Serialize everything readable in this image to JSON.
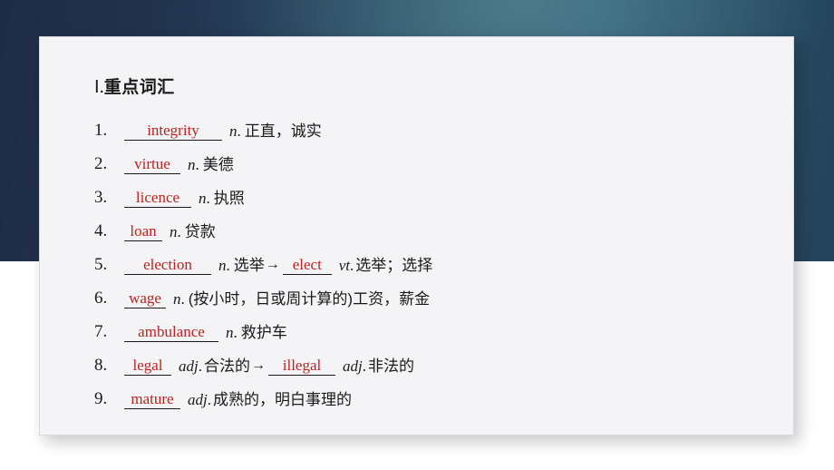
{
  "slide": {
    "section_title_numeral": "Ⅰ",
    "section_title_dot": ".",
    "section_title_text": "重点词汇"
  },
  "vocab": {
    "items": [
      {
        "num": "1.",
        "answer": "integrity",
        "pos": "n",
        "pos_dot": ".",
        "meaning": "正直，诚实",
        "arrow": "",
        "answer2": "",
        "pos2": "",
        "pos2_dot": "",
        "meaning2": ""
      },
      {
        "num": "2.",
        "answer": "virtue",
        "pos": "n",
        "pos_dot": ".",
        "meaning": "美德",
        "arrow": "",
        "answer2": "",
        "pos2": "",
        "pos2_dot": "",
        "meaning2": ""
      },
      {
        "num": "3.",
        "answer": "licence",
        "pos": "n",
        "pos_dot": ".",
        "meaning": "执照",
        "arrow": "",
        "answer2": "",
        "pos2": "",
        "pos2_dot": "",
        "meaning2": ""
      },
      {
        "num": "4.",
        "answer": "loan",
        "pos": "n",
        "pos_dot": ".",
        "meaning": "贷款",
        "arrow": "",
        "answer2": "",
        "pos2": "",
        "pos2_dot": "",
        "meaning2": ""
      },
      {
        "num": "5.",
        "answer": "election",
        "pos": "n",
        "pos_dot": ".",
        "meaning": "选举",
        "arrow": "→",
        "answer2": "elect",
        "pos2": "vt",
        "pos2_dot": ".",
        "meaning2": "选举；选择"
      },
      {
        "num": "6.",
        "answer": "wage",
        "pos": "n",
        "pos_dot": ".",
        "meaning": "(按小时，日或周计算的)工资，薪金",
        "arrow": "",
        "answer2": "",
        "pos2": "",
        "pos2_dot": "",
        "meaning2": ""
      },
      {
        "num": "7.",
        "answer": "ambulance",
        "pos": "n",
        "pos_dot": ".",
        "meaning": "救护车",
        "arrow": "",
        "answer2": "",
        "pos2": "",
        "pos2_dot": "",
        "meaning2": ""
      },
      {
        "num": "8.",
        "answer": "legal",
        "pos": "adj",
        "pos_dot": ".",
        "meaning": "合法的",
        "arrow": "→",
        "answer2": "illegal",
        "pos2": "adj",
        "pos2_dot": ".",
        "meaning2": "非法的"
      },
      {
        "num": "9.",
        "answer": "mature",
        "pos": "adj",
        "pos_dot": ".",
        "meaning": "成熟的，明白事理的",
        "arrow": "",
        "answer2": "",
        "pos2": "",
        "pos2_dot": "",
        "meaning2": ""
      }
    ]
  },
  "colors": {
    "answer_red": "#c0221f",
    "card_bg": "#f4f3f6",
    "text": "#1a1a1a",
    "bg_dark_navy": "#1d2b44",
    "bg_teal": "#2d5c7a"
  }
}
